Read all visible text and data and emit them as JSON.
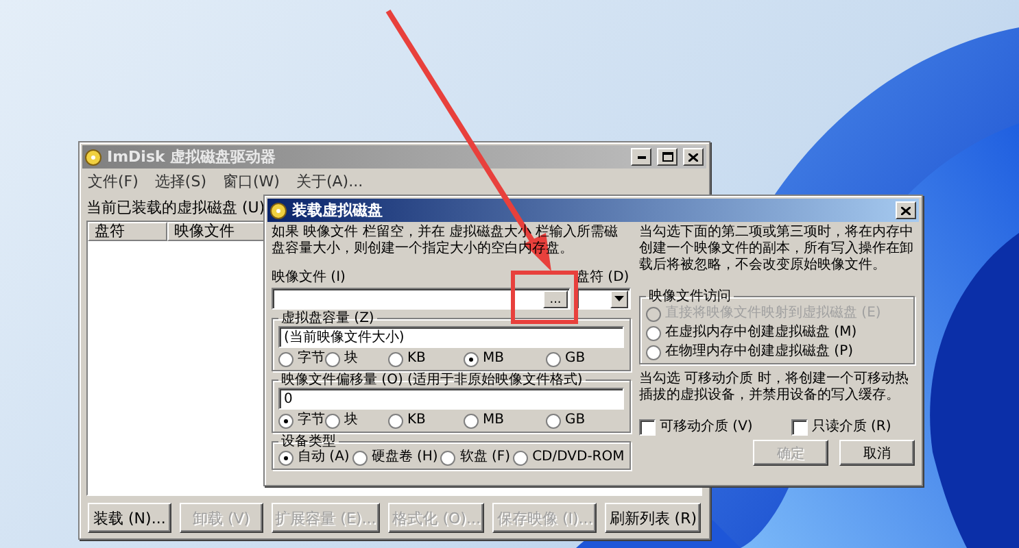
{
  "main_window": {
    "title": "ImDisk 虚拟磁盘驱动器",
    "menu": [
      "文件(F)",
      "选择(S)",
      "窗口(W)",
      "关于(A)..."
    ],
    "list_label": "当前已装载的虚拟磁盘 (U)",
    "columns": [
      "盘符",
      "映像文件"
    ],
    "buttons": [
      {
        "label": "装载 (N)...",
        "disabled": false
      },
      {
        "label": "卸载 (V)",
        "disabled": true
      },
      {
        "label": "扩展容量 (E)...",
        "disabled": true
      },
      {
        "label": "格式化 (O)...",
        "disabled": true
      },
      {
        "label": "保存映像 (I)...",
        "disabled": true
      },
      {
        "label": "刷新列表 (R)",
        "disabled": false
      }
    ]
  },
  "dialog": {
    "title": "装载虚拟磁盘",
    "intro": "如果 映像文件 栏留空，并在 虚拟磁盘大小 栏输入所需磁盘容量大小，则创建一个指定大小的空白内存盘。",
    "image_file": {
      "label": "映像文件 (I)",
      "browse_button": "..."
    },
    "drive": {
      "label": "盘符 (D)"
    },
    "size": {
      "label": "虚拟盘容量 (Z)",
      "value": "(当前映像文件大小)",
      "units": [
        {
          "label": "字节",
          "selected": false
        },
        {
          "label": "块",
          "selected": false
        },
        {
          "label": "KB",
          "selected": false
        },
        {
          "label": "MB",
          "selected": true
        },
        {
          "label": "GB",
          "selected": false
        }
      ]
    },
    "offset": {
      "label": "映像文件偏移量 (O)  (适用于非原始映像文件格式)",
      "value": "0",
      "units": [
        {
          "label": "字节",
          "selected": true
        },
        {
          "label": "块",
          "selected": false
        },
        {
          "label": "KB",
          "selected": false
        },
        {
          "label": "MB",
          "selected": false
        },
        {
          "label": "GB",
          "selected": false
        }
      ]
    },
    "device_type": {
      "label": "设备类型",
      "options": [
        {
          "label": "自动 (A)",
          "selected": true
        },
        {
          "label": "硬盘卷 (H)",
          "selected": false
        },
        {
          "label": "软盘 (F)",
          "selected": false
        },
        {
          "label": "CD/DVD-ROM",
          "selected": false
        }
      ]
    },
    "access_note": "当勾选下面的第二项或第三项时，将在内存中创建一个映像文件的副本，所有写入操作在卸载后将被忽略，不会改变原始映像文件。",
    "access": {
      "label": "映像文件访问",
      "options": [
        {
          "label": "直接将映像文件映射到虚拟磁盘 (E)",
          "selected": false,
          "disabled": true
        },
        {
          "label": "在虚拟内存中创建虚拟磁盘 (M)",
          "selected": false,
          "disabled": false
        },
        {
          "label": "在物理内存中创建虚拟磁盘 (P)",
          "selected": false,
          "disabled": false
        }
      ]
    },
    "removable_note": "当勾选 可移动介质 时，将创建一个可移动热插拔的虚拟设备，并禁用设备的写入缓存。",
    "checks": [
      {
        "label": "可移动介质 (V)",
        "checked": false
      },
      {
        "label": "只读介质 (R)",
        "checked": false
      }
    ],
    "buttons": [
      {
        "label": "确定",
        "disabled": true
      },
      {
        "label": "取消",
        "disabled": false
      }
    ]
  }
}
